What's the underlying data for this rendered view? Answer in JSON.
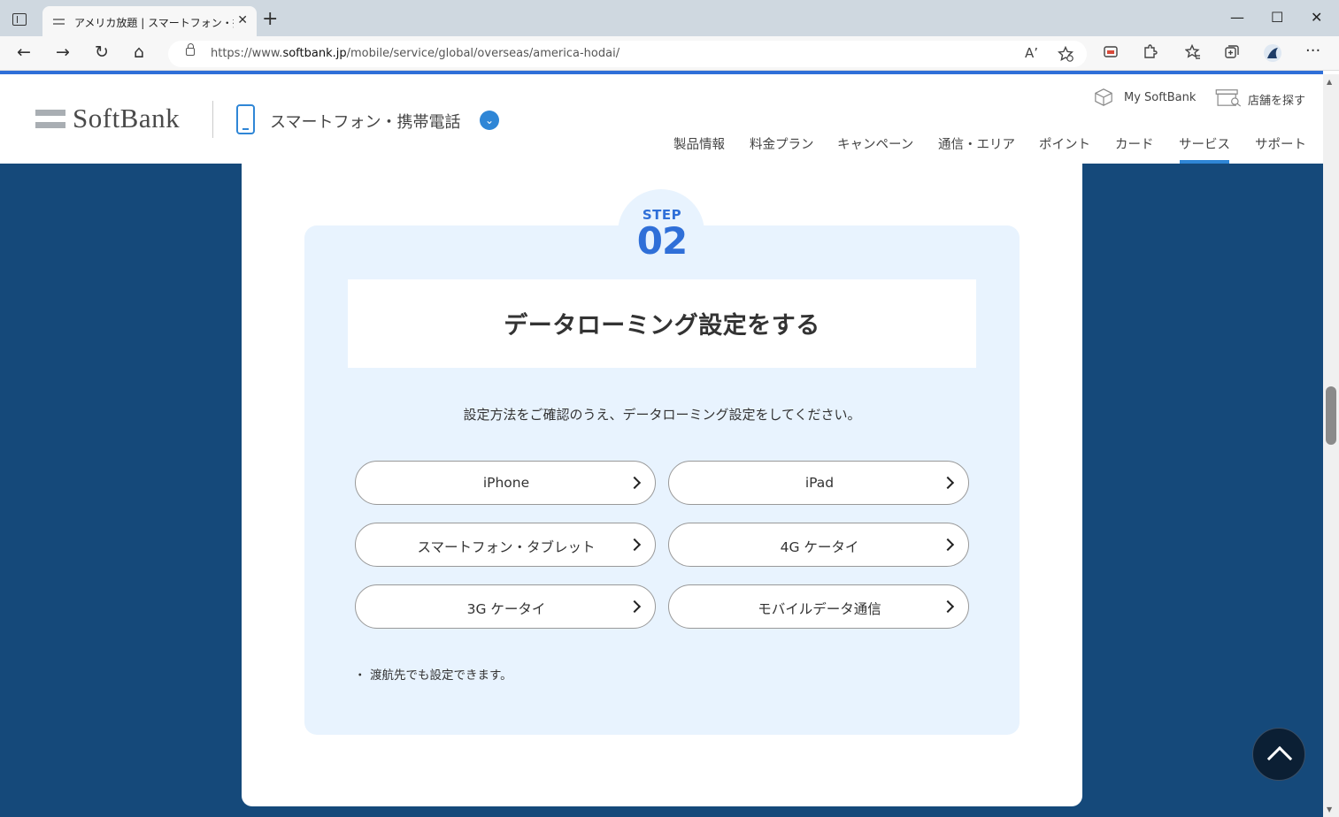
{
  "browser": {
    "tab_title": "アメリカ放題 | スマートフォン・携帯電話",
    "tab_close": "✕",
    "new_tab": "+",
    "url_prefix": "https://www.",
    "url_domain": "softbank.jp",
    "url_path": "/mobile/service/global/overseas/america-hodai/",
    "read_aloud_glyph": "A’",
    "back_glyph": "←",
    "forward_glyph": "→",
    "refresh_glyph": "↻",
    "home_glyph": "⌂",
    "minimize_glyph": "—",
    "maximize_glyph": "☐",
    "close_glyph": "✕",
    "more_glyph": "···",
    "icons": [
      "tab-strip-icon",
      "back-icon",
      "forward-icon",
      "refresh-icon",
      "home-icon",
      "lock-icon",
      "read-aloud-icon",
      "add-favorite-icon",
      "app-icon",
      "extensions-icon",
      "favorites-icon",
      "collections-icon",
      "profile-icon",
      "more-icon"
    ]
  },
  "header": {
    "logo_text": "SoftBank",
    "product_label": "スマートフォン・携帯電話",
    "chevron_glyph": "⌄",
    "utility": {
      "my_softbank": "My SoftBank",
      "store_search": "店舗を探す"
    },
    "nav": [
      "製品情報",
      "料金プラン",
      "キャンペーン",
      "通信・エリア",
      "ポイント",
      "カード",
      "サービス",
      "サポート"
    ],
    "active_nav": "サービス"
  },
  "step": {
    "label": "STEP",
    "number": "02",
    "title": "データローミング設定をする",
    "description": "設定方法をご確認のうえ、データローミング設定をしてください。",
    "buttons": [
      "iPhone",
      "iPad",
      "スマートフォン・タブレット",
      "4G ケータイ",
      "3G ケータイ",
      "モバイルデータ通信"
    ],
    "note_bullet": "・",
    "note": "渡航先でも設定できます。"
  },
  "colors": {
    "accent": "#2f6fd8",
    "page_background": "#15497a",
    "panel": "#e8f3fe",
    "to_top": "#0b1f34"
  }
}
